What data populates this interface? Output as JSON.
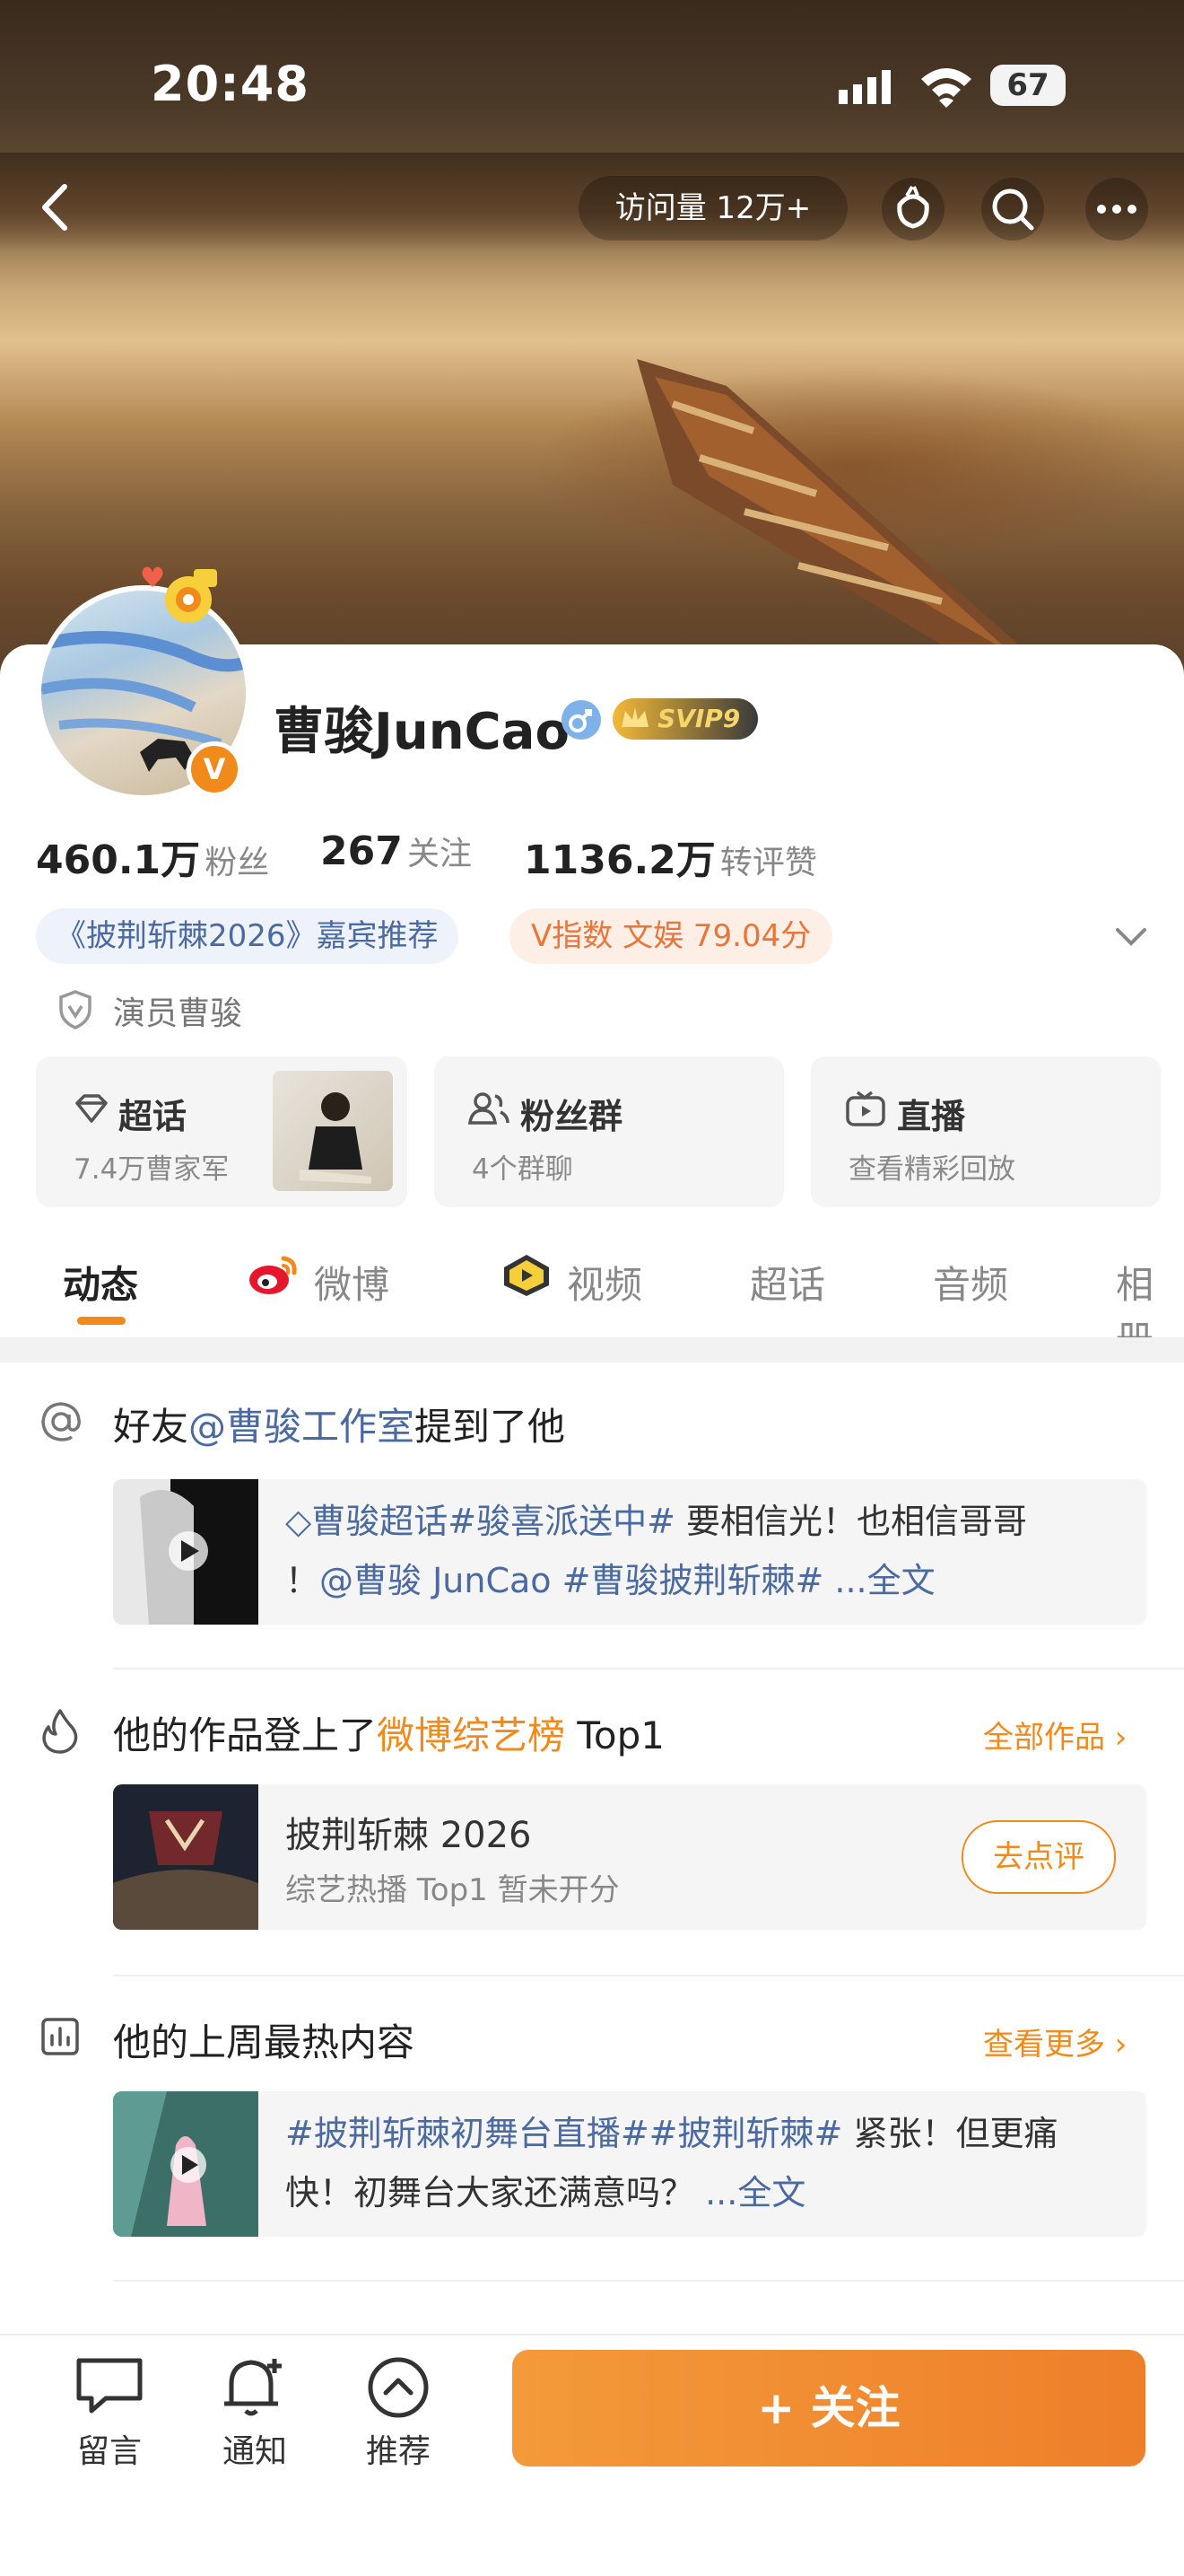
{
  "status_bar": {
    "time": "20:48",
    "battery": "67"
  },
  "header": {
    "visits_label": "访问量 12万+"
  },
  "profile": {
    "name": "曹骏JunCao",
    "svip_label": "SVIP9",
    "stats": [
      {
        "value": "460.1万",
        "label": "粉丝"
      },
      {
        "value": "267",
        "label": "关注"
      },
      {
        "value": "1136.2万",
        "label": "转评赞"
      }
    ],
    "tags": {
      "guest": "《披荆斩棘2026》嘉宾推荐",
      "v_index": "V指数 文娱 79.04分"
    },
    "role": "演员曹骏"
  },
  "boxes": [
    {
      "title": "超话",
      "sub": "7.4万曹家军"
    },
    {
      "title": "粉丝群",
      "sub": "4个群聊"
    },
    {
      "title": "直播",
      "sub": "查看精彩回放"
    }
  ],
  "tabs": [
    "动态",
    "微博",
    "视频",
    "超话",
    "音频",
    "相册"
  ],
  "feed": {
    "mention": {
      "prefix": "好友",
      "handle": "@曹骏工作室",
      "suffix": "提到了他",
      "line1_link": "曹骏超话#骏喜派送中#",
      "line1_text": " 要相信光！也相信哥哥",
      "line2_prefix": "！",
      "line2_link": "@曹骏 JunCao #曹骏披荆斩棘#",
      "line2_more": " ...全文"
    },
    "works": {
      "prefix": "他的作品登上了",
      "highlight": "微博综艺榜",
      "suffix": " Top1",
      "all_link": "全部作品 ›",
      "show_title": "披荆斩棘 2026",
      "show_sub": "综艺热播 Top1 暂未开分",
      "rate_btn": "去点评"
    },
    "hot": {
      "title": "他的上周最热内容",
      "more_link": "查看更多 ›",
      "line1_link": "#披荆斩棘初舞台直播##披荆斩棘#",
      "line1_text": " 紧张！但更痛",
      "line2_text": "快！初舞台大家还满意吗？ ",
      "line2_more": "...全文"
    }
  },
  "bottom_bar": {
    "message": "留言",
    "notify": "通知",
    "recommend": "推荐",
    "follow": "+ 关注"
  },
  "colors": {
    "accent": "#f08a1a",
    "link": "#4a6aa0"
  }
}
